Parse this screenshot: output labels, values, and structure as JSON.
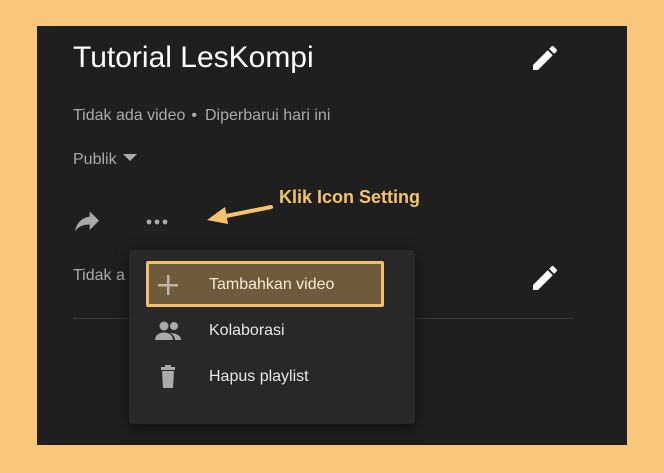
{
  "playlist": {
    "title": "Tutorial LesKompi",
    "video_count": "Tidak ada video",
    "separator": "•",
    "updated": "Diperbarui hari ini",
    "privacy": "Publik",
    "description_partial": "Tidak a"
  },
  "annotation": {
    "text": "Klik Icon Setting",
    "color": "#f5c36b"
  },
  "menu": {
    "items": [
      {
        "label": "Tambahkan video",
        "icon": "plus-icon"
      },
      {
        "label": "Kolaborasi",
        "icon": "people-icon"
      },
      {
        "label": "Hapus playlist",
        "icon": "trash-icon"
      }
    ]
  },
  "icons": {
    "edit": "pencil-icon",
    "share": "share-icon",
    "more": "more-horizontal-icon"
  },
  "colors": {
    "background": "#f8c77b",
    "panel": "#1f1f1f",
    "menu": "#282828",
    "highlight_border": "#f2bf6a"
  }
}
